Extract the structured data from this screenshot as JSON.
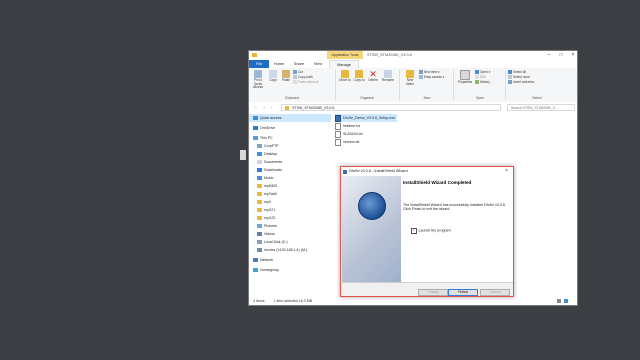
{
  "explorer": {
    "context_tab": "Application Tools",
    "title": "STSW_STM32080_V3.0.6",
    "tabs": [
      "File",
      "Home",
      "Share",
      "View",
      "Manage"
    ],
    "ribbon": {
      "pin": "Pin to Quick access",
      "copy": "Copy",
      "paste": "Paste",
      "cut": "Cut",
      "copy_path": "Copy path",
      "paste_shortcut": "Paste shortcut",
      "move_to": "Move to",
      "copy_to": "Copy to",
      "delete": "Delete",
      "rename": "Rename",
      "new_folder": "New folder",
      "new_item": "New item",
      "easy_access": "Easy access",
      "properties": "Properties",
      "open": "Open",
      "edit": "Edit",
      "history": "History",
      "select_all": "Select all",
      "select_none": "Select none",
      "invert_selection": "Invert selection",
      "groups": [
        "Clipboard",
        "Organize",
        "New",
        "Open",
        "Select"
      ]
    },
    "address": "STSW_STM32080_V3.0.6",
    "search_placeholder": "Search STSW_STM32080_V...",
    "nav": [
      "Quick access",
      "OneDrive",
      "This PC",
      "CorpFTP",
      "Desktop",
      "Documents",
      "Downloads",
      "Music",
      "myK820",
      "myTab8",
      "myX",
      "myX21",
      "myXZ2",
      "Pictures",
      "Videos",
      "Local Disk (C:)",
      "movies (\\\\192.168.1.4) (M:)",
      "Network",
      "Homegroup"
    ],
    "files": [
      "DfuSe_Demo_V3.0.6_Setup.exe",
      "readme.txt",
      "SLA0044.txt",
      "version.txt"
    ],
    "status": {
      "items": "4 items",
      "selected": "1 item selected 16.3 MB"
    }
  },
  "dialog": {
    "title": "DfuSe v3.0.6 - InstallShield Wizard",
    "heading": "InstallShield Wizard Completed",
    "body": "The InstallShield Wizard has successfully installed DfuSe v3.0.6. Click Finish to exit the wizard.",
    "checkbox_label": "Launch the program",
    "back": "< Back",
    "finish": "Finish",
    "cancel": "Cancel"
  },
  "colors": {
    "desktop": "#3b3f44",
    "file_tab": "#1e6fc1",
    "context_tab": "#f6d77d",
    "selection": "#cce8ff",
    "dialog_border": "#e8524a"
  }
}
